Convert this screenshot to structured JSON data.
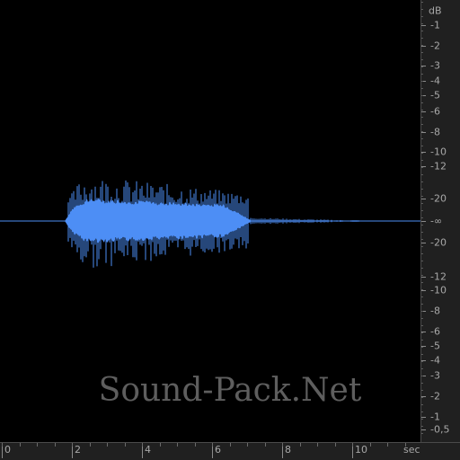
{
  "db_ruler": {
    "unit": "dB",
    "labels": [
      "-1",
      "-2",
      "-3",
      "-4",
      "-5",
      "-6",
      "-8",
      "-10",
      "-12",
      "-20",
      "-∞",
      "-20",
      "-12",
      "-10",
      "-8",
      "-6",
      "-5",
      "-4",
      "-3",
      "-2",
      "-1",
      "-0,5"
    ]
  },
  "time_ruler": {
    "unit": "sec",
    "labels": [
      "0",
      "2",
      "4",
      "6",
      "8",
      "10"
    ]
  },
  "watermark": "Sound-Pack.Net",
  "colors": {
    "waveform": "#4d8ef5",
    "background": "#000000",
    "ruler": "#202020",
    "text": "#a8a8a8"
  },
  "waveform": {
    "duration_sec": 12,
    "onset_sec": 2,
    "offset_sec": 7.2,
    "peak_db": -12
  }
}
